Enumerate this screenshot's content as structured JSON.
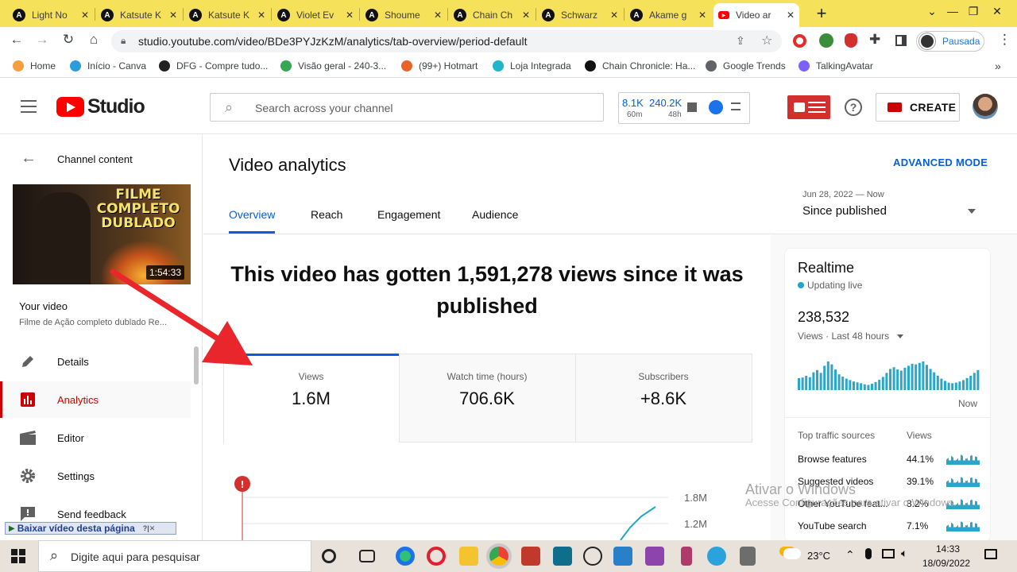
{
  "browser": {
    "tabs": [
      {
        "title": "Light No",
        "active": false
      },
      {
        "title": "Katsute K",
        "active": false
      },
      {
        "title": "Katsute K",
        "active": false
      },
      {
        "title": "Violet Ev",
        "active": false
      },
      {
        "title": "Shoume",
        "active": false
      },
      {
        "title": "Chain Ch",
        "active": false
      },
      {
        "title": "Schwarz",
        "active": false
      },
      {
        "title": "Akame g",
        "active": false
      },
      {
        "title": "Video ar",
        "active": true
      }
    ],
    "new_tab": "+",
    "close_glyph": "✕",
    "url": "studio.youtube.com/video/BDe3PYJzKzM/analytics/tab-overview/period-default",
    "profile_label": "Pausada",
    "bookmarks": [
      "Home",
      "Início - Canva",
      "DFG - Compre tudo...",
      "Visão geral - 240-3...",
      "(99+) Hotmart",
      "Loja Integrada",
      "Chain Chronicle: Ha...",
      "Google Trends",
      "TalkingAvatar"
    ],
    "more_bookmarks": "»",
    "colors": {
      "tabbar": "#f6e25a",
      "accent": "#065fd4",
      "brand_red": "#ff0000"
    }
  },
  "studio": {
    "logo_text": "Studio",
    "search_placeholder": "Search across your channel",
    "stats": {
      "a_value": "8.1K",
      "a_label": "60m",
      "b_value": "240.2K",
      "b_label": "48h"
    },
    "create_label": "CREATE"
  },
  "sidebar": {
    "back_label": "Channel content",
    "thumb_text": [
      "FILME",
      "COMPLETO",
      "DUBLADO"
    ],
    "duration": "1:54:33",
    "your_video_label": "Your video",
    "video_title": "Filme de Ação completo dublado Re...",
    "items": [
      {
        "label": "Details",
        "icon": "pencil-icon",
        "active": false
      },
      {
        "label": "Analytics",
        "icon": "analytics-icon",
        "active": true
      },
      {
        "label": "Editor",
        "icon": "editor-icon",
        "active": false
      },
      {
        "label": "Settings",
        "icon": "gear-icon",
        "active": false
      },
      {
        "label": "Send feedback",
        "icon": "feedback-icon",
        "active": false
      }
    ],
    "download_bar": "Baixar vídeo desta página",
    "download_bar_extra": "?|✕"
  },
  "main": {
    "title": "Video analytics",
    "advanced_mode": "ADVANCED MODE",
    "period_range": "Jun 28, 2022 — Now",
    "period_label": "Since published",
    "tabs": [
      {
        "label": "Overview",
        "active": true
      },
      {
        "label": "Reach",
        "active": false
      },
      {
        "label": "Engagement",
        "active": false
      },
      {
        "label": "Audience",
        "active": false
      }
    ],
    "headline": "This video has gotten 1,591,278 views since it was published",
    "kpis": [
      {
        "label": "Views",
        "value": "1.6M"
      },
      {
        "label": "Watch time (hours)",
        "value": "706.6K"
      },
      {
        "label": "Subscribers",
        "value": "+8.6K"
      }
    ],
    "chart_ticks": [
      "1.8M",
      "1.2M"
    ]
  },
  "realtime": {
    "title": "Realtime",
    "status": "Updating live",
    "value": "238,532",
    "metric_label": "Views · Last 48 hours",
    "bars": [
      0.42,
      0.44,
      0.5,
      0.45,
      0.62,
      0.7,
      0.6,
      0.85,
      1.0,
      0.9,
      0.72,
      0.55,
      0.47,
      0.4,
      0.35,
      0.3,
      0.27,
      0.24,
      0.2,
      0.18,
      0.22,
      0.28,
      0.36,
      0.46,
      0.6,
      0.74,
      0.8,
      0.72,
      0.68,
      0.78,
      0.85,
      0.92,
      0.9,
      0.95,
      1.0,
      0.88,
      0.74,
      0.62,
      0.5,
      0.4,
      0.32,
      0.26,
      0.24,
      0.26,
      0.3,
      0.35,
      0.42,
      0.5,
      0.6,
      0.7
    ],
    "now_label": "Now",
    "sources_header": "Top traffic sources",
    "sources_col": "Views",
    "sources": [
      {
        "name": "Browse features",
        "pct": "44.1%"
      },
      {
        "name": "Suggested videos",
        "pct": "39.1%"
      },
      {
        "name": "Other YouTube feat...",
        "pct": "8.2%"
      },
      {
        "name": "YouTube search",
        "pct": "7.1%"
      }
    ]
  },
  "watermark": {
    "line1": "Ativar o Windows",
    "line2": "Acesse Configurações para ativar o Windows."
  },
  "taskbar": {
    "search_placeholder": "Digite aqui para pesquisar",
    "weather": "23°C",
    "time": "14:33",
    "date": "18/09/2022"
  }
}
